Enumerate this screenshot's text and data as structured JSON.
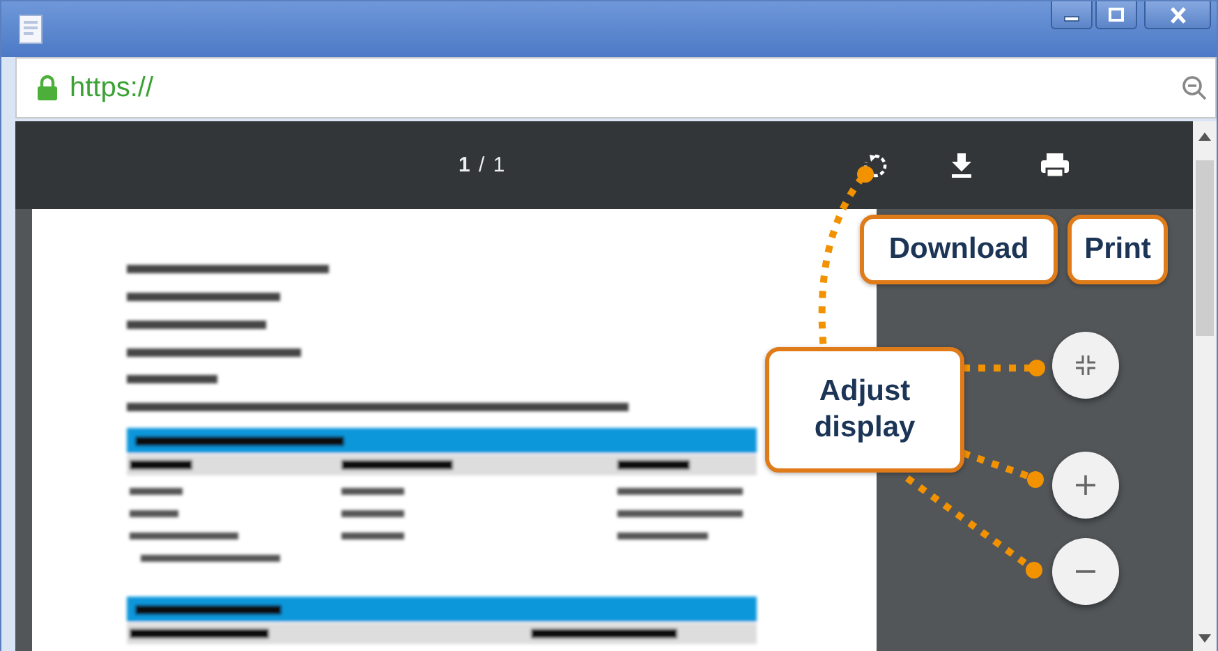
{
  "address_bar": {
    "url": "https://"
  },
  "viewer": {
    "page_indicator": "**1** / 1"
  },
  "callouts": [
    {
      "kind": "download",
      "text": "Download"
    },
    {
      "kind": "print",
      "text": "Print"
    },
    {
      "kind": "adjust",
      "text": "Adjust display"
    }
  ]
}
